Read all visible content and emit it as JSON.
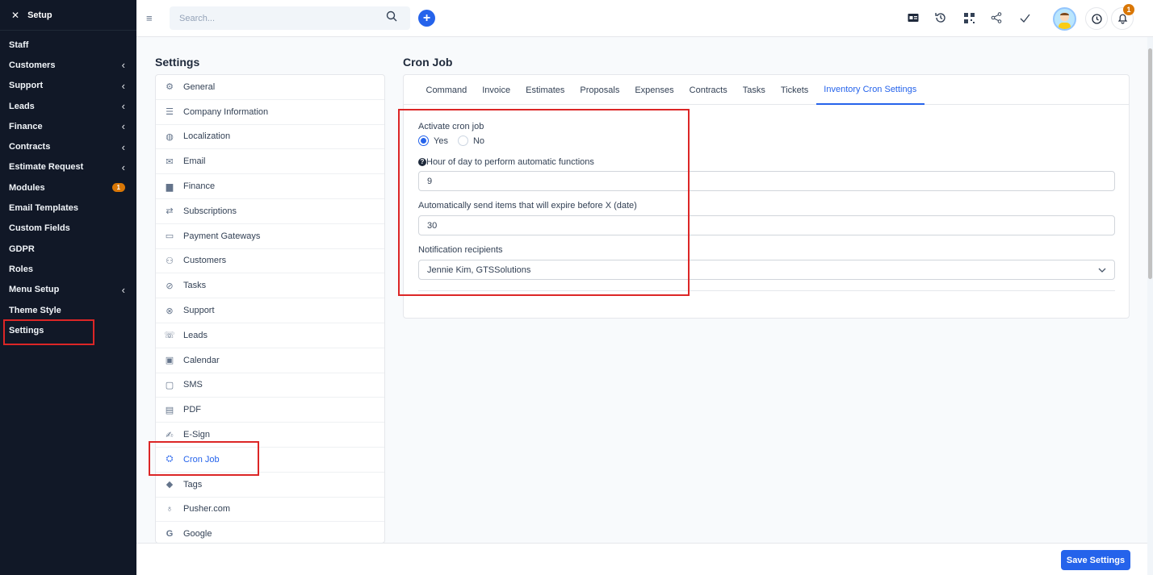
{
  "sidebar": {
    "header": "Setup",
    "items": [
      {
        "label": "Staff",
        "chevron": false
      },
      {
        "label": "Customers",
        "chevron": true
      },
      {
        "label": "Support",
        "chevron": true
      },
      {
        "label": "Leads",
        "chevron": true
      },
      {
        "label": "Finance",
        "chevron": true
      },
      {
        "label": "Contracts",
        "chevron": true
      },
      {
        "label": "Estimate Request",
        "chevron": true
      },
      {
        "label": "Modules",
        "badge": "1"
      },
      {
        "label": "Email Templates"
      },
      {
        "label": "Custom Fields"
      },
      {
        "label": "GDPR"
      },
      {
        "label": "Roles"
      },
      {
        "label": "Menu Setup",
        "chevron": true
      },
      {
        "label": "Theme Style"
      },
      {
        "label": "Settings",
        "active": true
      }
    ]
  },
  "topbar": {
    "search_placeholder": "Search...",
    "notification_count": "1"
  },
  "settings": {
    "title": "Settings",
    "items": [
      "General",
      "Company Information",
      "Localization",
      "Email",
      "Finance",
      "Subscriptions",
      "Payment Gateways",
      "Customers",
      "Tasks",
      "Support",
      "Leads",
      "Calendar",
      "SMS",
      "PDF",
      "E-Sign",
      "Cron Job",
      "Tags",
      "Pusher.com",
      "Google"
    ],
    "active": "Cron Job"
  },
  "main": {
    "title": "Cron Job",
    "tabs": [
      "Command",
      "Invoice",
      "Estimates",
      "Proposals",
      "Expenses",
      "Contracts",
      "Tasks",
      "Tickets",
      "Inventory Cron Settings"
    ],
    "active_tab": "Inventory Cron Settings",
    "form": {
      "activate_label": "Activate cron job",
      "yes_label": "Yes",
      "no_label": "No",
      "activate_value": "Yes",
      "hour_label": "Hour of day to perform automatic functions",
      "hour_value": "9",
      "expire_label": "Automatically send items that will expire before X (date)",
      "expire_value": "30",
      "recipients_label": "Notification recipients",
      "recipients_value": "Jennie Kim, GTSSolutions"
    }
  },
  "footer": {
    "save_label": "Save Settings"
  },
  "colors": {
    "accent": "#2563eb",
    "sidebar_bg": "#111827",
    "highlight": "#dc2626",
    "badge": "#d97706"
  }
}
